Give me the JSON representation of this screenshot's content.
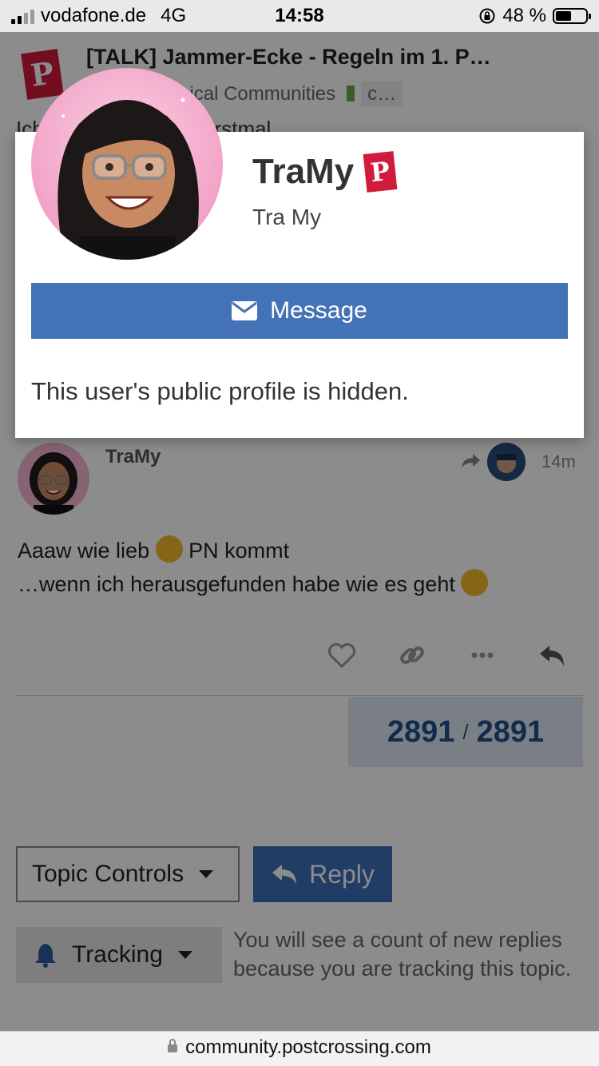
{
  "status_bar": {
    "carrier": "vodafone.de",
    "network": "4G",
    "time": "14:58",
    "battery_percent": "48 %",
    "battery_level": 0.48
  },
  "topic": {
    "title": "[TALK] Jammer-Ecke - Regeln im 1. P…",
    "category": "& Geographical Communities",
    "tag": "c…",
    "snippet": "Ich … Karten aus D erstmal"
  },
  "user_card": {
    "username": "TraMy",
    "full_name": "Tra My",
    "message_label": "Message",
    "hidden_profile_text": "This user's public profile is hidden."
  },
  "post": {
    "username": "TraMy",
    "age": "14m",
    "line1_before": "Aaaw wie lieb",
    "line1_after": "PN kommt",
    "line2": "…wenn ich herausgefunden habe wie es geht"
  },
  "progress": {
    "current": "2891",
    "separator": "/",
    "total": "2891"
  },
  "footer_controls": {
    "topic_controls_label": "Topic Controls",
    "reply_label": "Reply",
    "tracking_label": "Tracking",
    "tracking_description": "You will see a count of new replies because you are tracking this topic."
  },
  "url_bar": {
    "domain": "community.postcrossing.com"
  }
}
